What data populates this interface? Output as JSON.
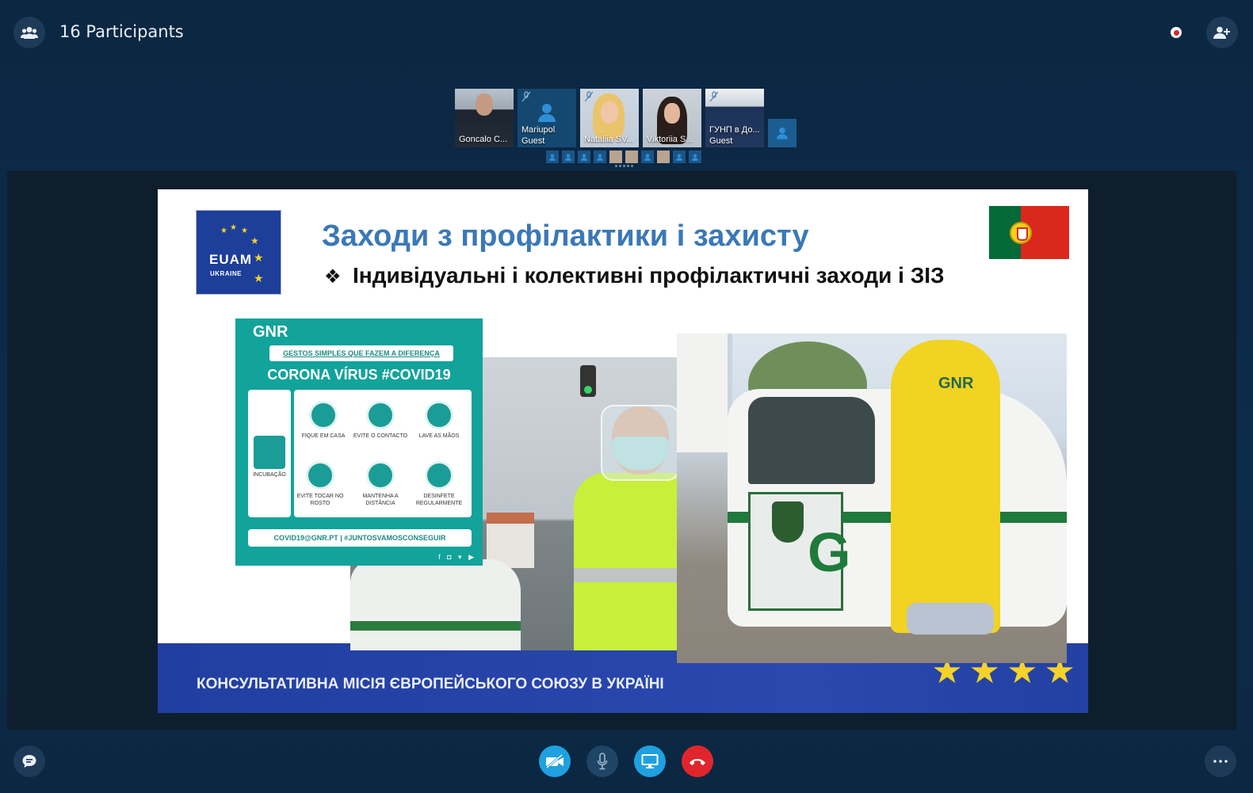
{
  "header": {
    "participants_label": "16 Participants"
  },
  "participants": [
    {
      "name": "Goncalo C...",
      "sub": "",
      "muted": false
    },
    {
      "name": "Mariupol",
      "sub": "Guest",
      "muted": true
    },
    {
      "name": "Nataliia SV...",
      "sub": "",
      "muted": true
    },
    {
      "name": "Viktoriia S...",
      "sub": "",
      "muted": false
    },
    {
      "name": "ГУНП в До...",
      "sub": "Guest",
      "muted": true
    }
  ],
  "slide": {
    "logo_main": "EUAM",
    "logo_sub": "UKRAINE",
    "title": "Заходи з профілактики і захисту",
    "bullet_mark": "❖",
    "bullet": "Індивідуальні і колективні профілактичні заходи і ЗІЗ",
    "footer": "КОНСУЛЬТАТИВНА МІСІЯ ЄВРОПЕЙСЬКОГО СОЮЗУ В УКРАЇНІ",
    "poster": {
      "brand": "GNR",
      "subtitle": "GESTOS SIMPLES QUE FAZEM A DIFERENÇA",
      "heading": "CORONA VÍRUS #COVID19",
      "incubation": "INCUBAÇÃO",
      "items": [
        "FIQUE EM CASA",
        "EVITE O CONTACTO",
        "LAVE AS MÃOS",
        "EVITE TOCAR NO ROSTO",
        "MANTENHA A DISTÂNCIA",
        "DESINFETE REGULARMENTE"
      ],
      "footer": "COVID19@GNR.PT  |  #JUNTOSVAMOSCONSEGUIR",
      "social": "f ◘ ▾ ▶"
    },
    "photo2_label": "GNR"
  },
  "colors": {
    "background": "#0b2742",
    "accent": "#1fa1e0",
    "hangup": "#e0262c",
    "title": "#3b78b7"
  },
  "icons": {
    "participants": "people-icon",
    "record": "record-icon",
    "add_person": "add-person-icon",
    "chat": "chat-icon",
    "video": "video-off-icon",
    "mic": "microphone-icon",
    "share": "screen-share-icon",
    "hangup": "hang-up-icon",
    "more": "more-icon"
  }
}
